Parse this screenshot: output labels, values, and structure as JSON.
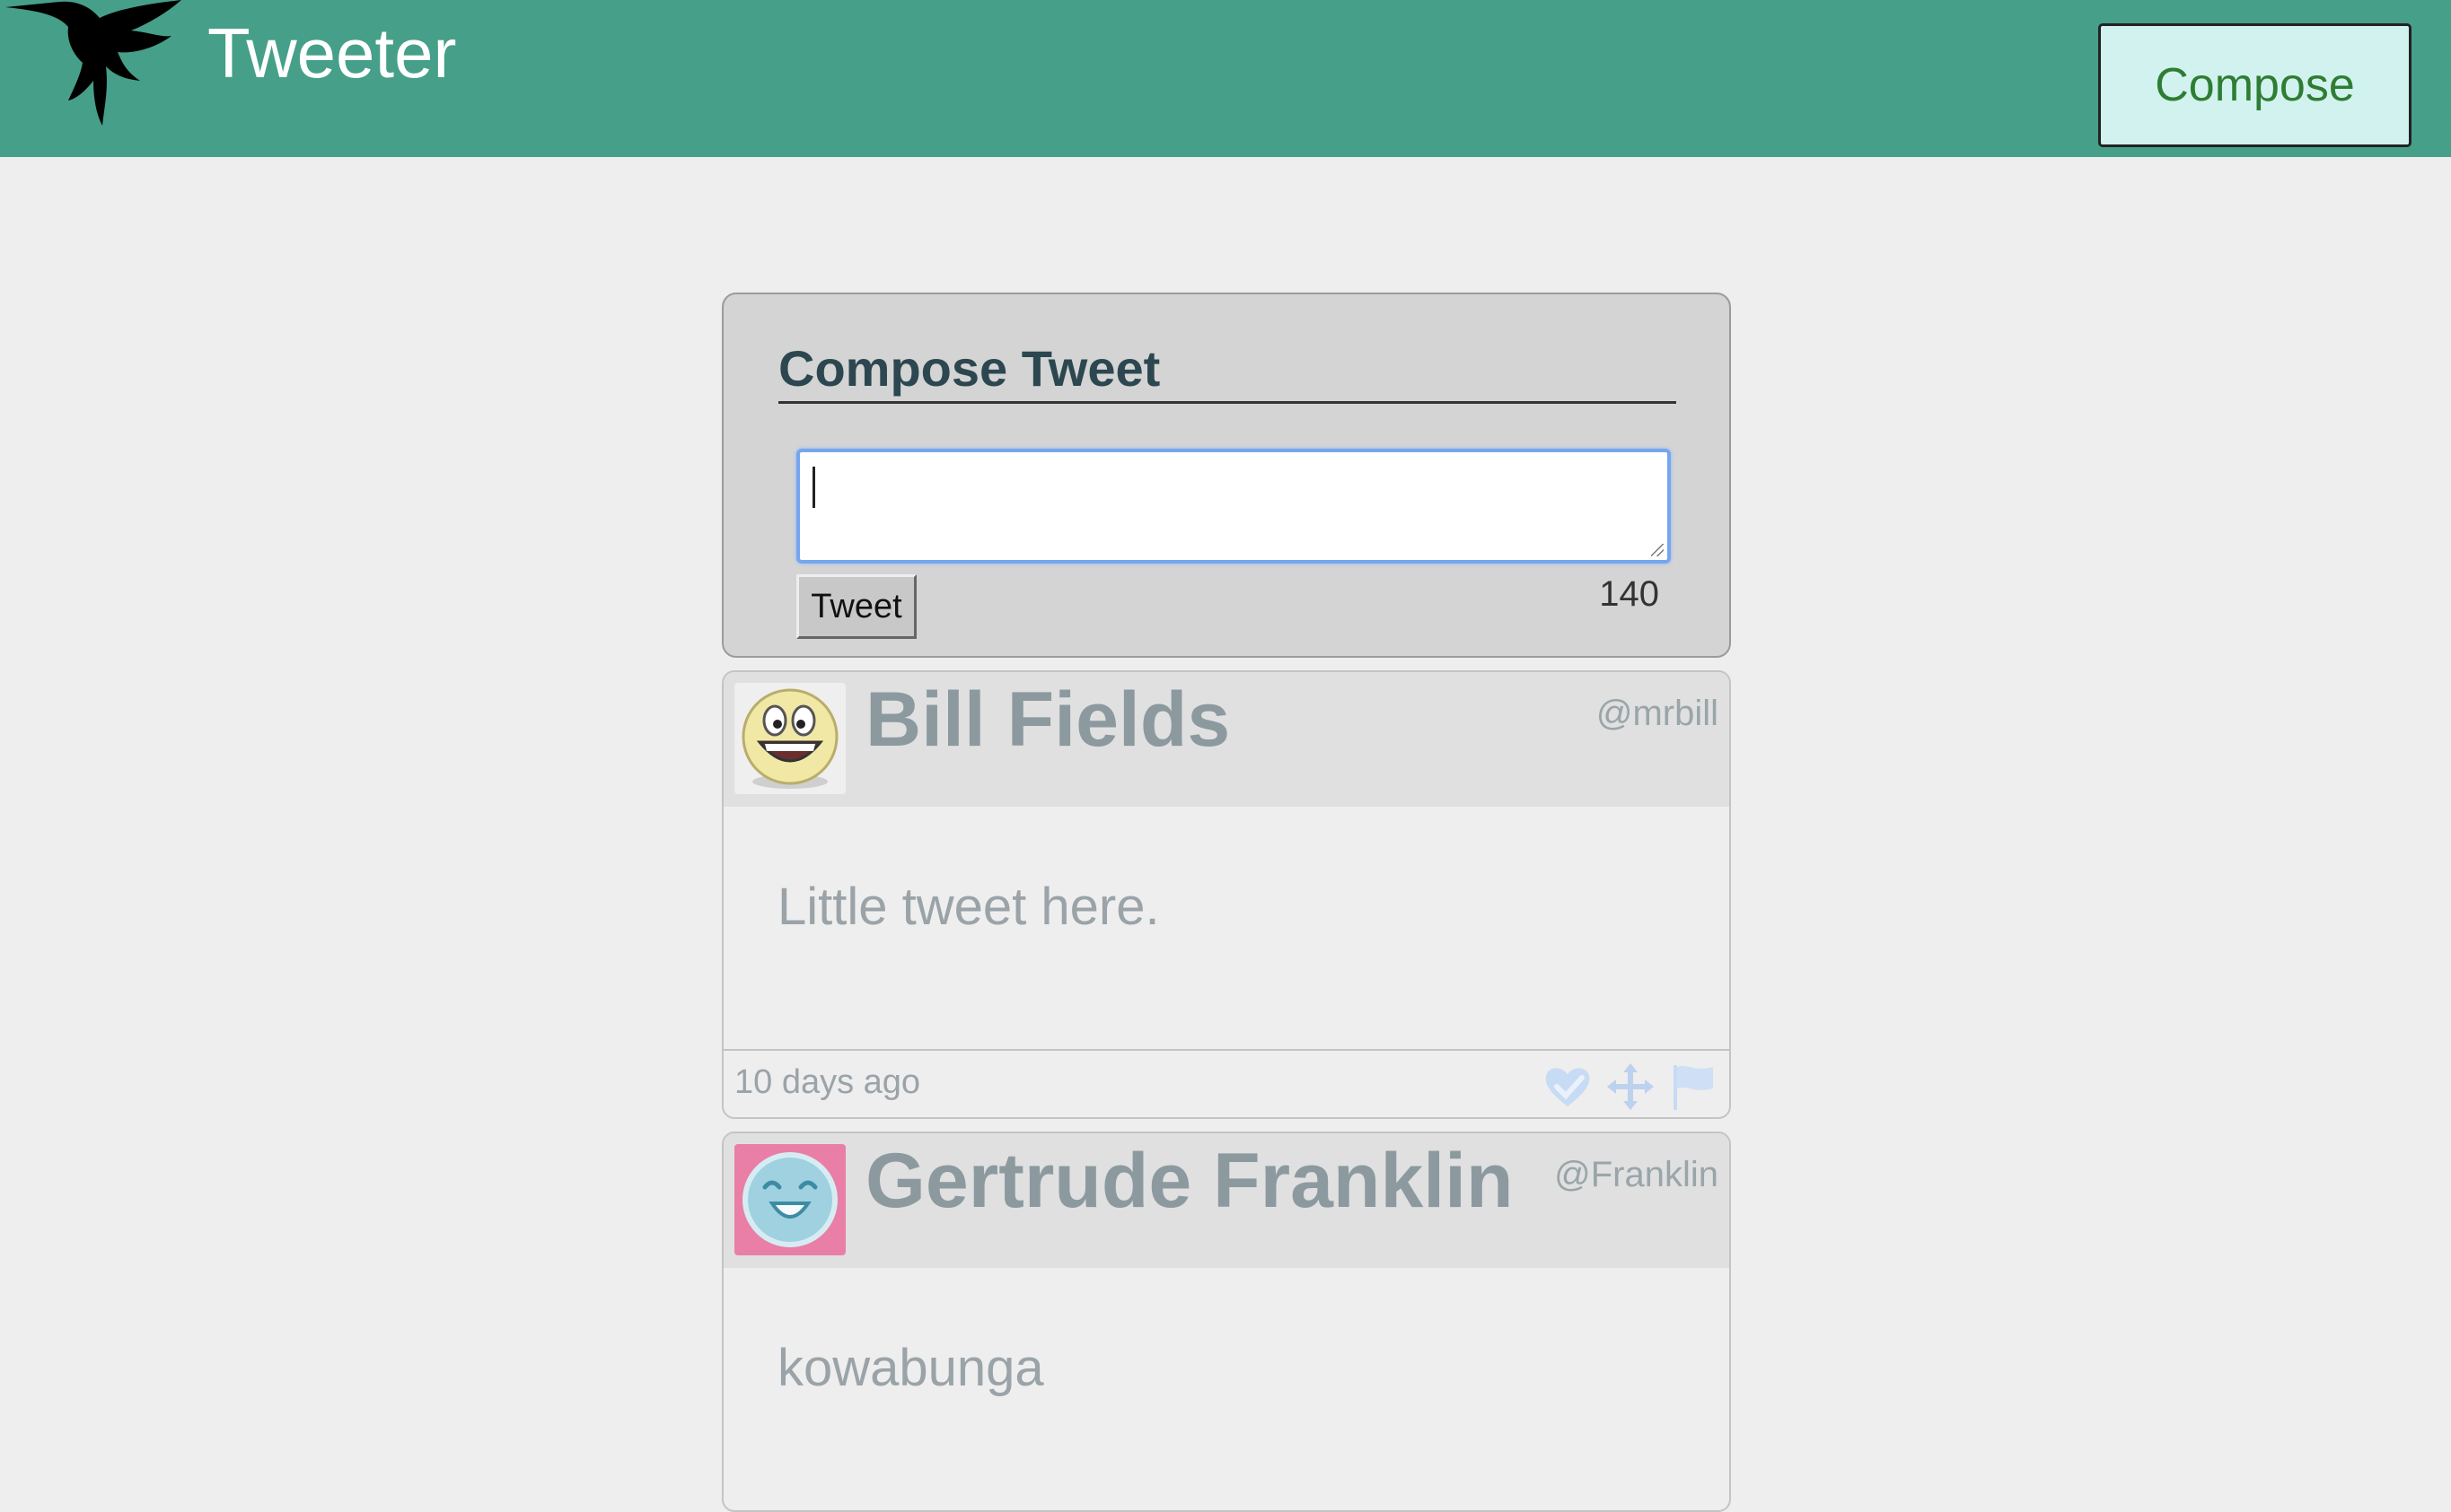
{
  "header": {
    "app_title": "Tweeter",
    "compose_label": "Compose",
    "logo_icon": "hummingbird-icon",
    "bg_color": "#469f89"
  },
  "compose": {
    "title": "Compose Tweet",
    "textarea_value": "",
    "submit_label": "Tweet",
    "counter": "140"
  },
  "tweets": [
    {
      "author": "Bill Fields",
      "handle": "@mrbill",
      "text": "Little tweet here.",
      "timestamp": "10 days ago",
      "avatar_icon": "smiley-avatar-icon"
    },
    {
      "author": "Gertrude Franklin",
      "handle": "@Franklin",
      "text": "kowabunga",
      "timestamp": "",
      "avatar_icon": "happy-face-avatar-icon"
    }
  ],
  "action_icons": [
    "heart-icon",
    "retweet-icon",
    "flag-icon"
  ]
}
